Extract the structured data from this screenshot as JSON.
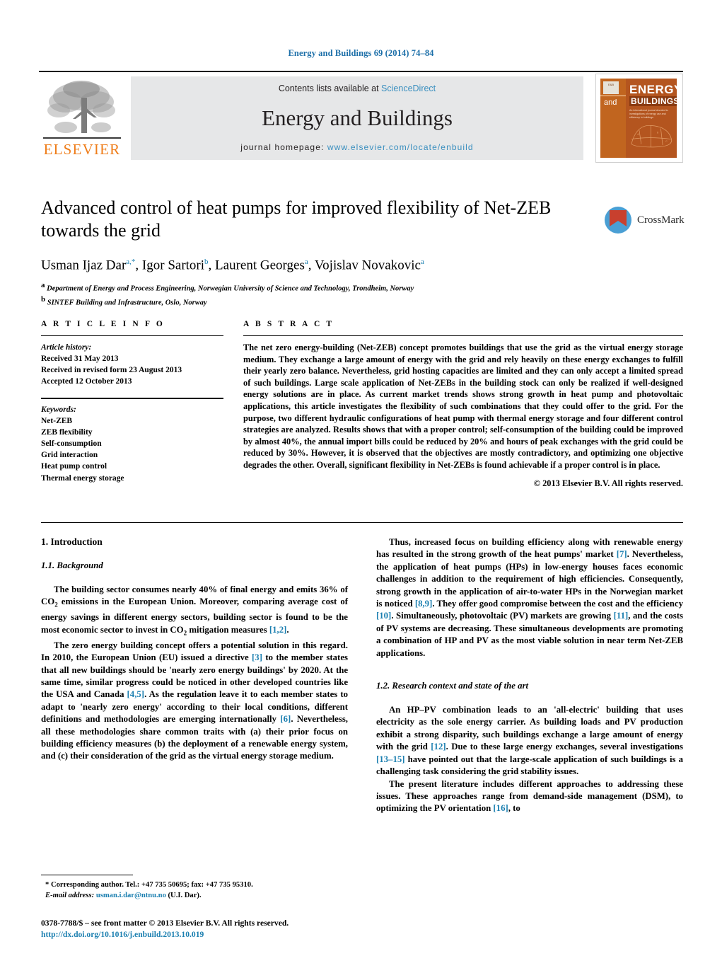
{
  "running_head": "Energy and Buildings 69 (2014) 74–84",
  "masthead": {
    "contents_prefix": "Contents lists available at ",
    "sciencedirect": "ScienceDirect",
    "journal_title": "Energy and Buildings",
    "homepage_prefix": "journal homepage:",
    "homepage_url": "www.elsevier.com/locate/enbuild",
    "publisher_logo_text": "ELSEVIER",
    "cover": {
      "badge": "ENERGY AND BUILDINGS",
      "and": "and",
      "energy": "ENERGY",
      "buildings": "BUILDINGS",
      "subtitle": "An international journal devoted to investigations of energy use and efficiency in buildings"
    }
  },
  "article": {
    "title": "Advanced control of heat pumps for improved flexibility of Net-ZEB towards the grid",
    "authors_html": "Usman Ijaz Dar<sup>a,*</sup>, Igor Sartori<sup>b</sup>, Laurent Georges<sup>a</sup>, Vojislav Novakovic<sup>a</sup>",
    "affiliations": [
      {
        "marker": "a",
        "text": "Department of Energy and Process Engineering, Norwegian University of Science and Technology, Trondheim, Norway"
      },
      {
        "marker": "b",
        "text": "SINTEF Building and Infrastructure, Oslo, Norway"
      }
    ],
    "crossmark_label": "CrossMark"
  },
  "article_info": {
    "heading": "A R T I C L E   I N F O",
    "history_label": "Article history:",
    "history": [
      "Received 31 May 2013",
      "Received in revised form 23 August 2013",
      "Accepted 12 October 2013"
    ],
    "keywords_label": "Keywords:",
    "keywords": [
      "Net-ZEB",
      "ZEB flexibility",
      "Self-consumption",
      "Grid interaction",
      "Heat pump control",
      "Thermal energy storage"
    ]
  },
  "abstract": {
    "heading": "A B S T R A C T",
    "text": "The net zero energy-building (Net-ZEB) concept promotes buildings that use the grid as the virtual energy storage medium. They exchange a large amount of energy with the grid and rely heavily on these energy exchanges to fulfill their yearly zero balance. Nevertheless, grid hosting capacities are limited and they can only accept a limited spread of such buildings. Large scale application of Net-ZEBs in the building stock can only be realized if well-designed energy solutions are in place. As current market trends shows strong growth in heat pump and photovoltaic applications, this article investigates the flexibility of such combinations that they could offer to the grid. For the purpose, two different hydraulic configurations of heat pump with thermal energy storage and four different control strategies are analyzed. Results shows that with a proper control; self-consumption of the building could be improved by almost 40%, the annual import bills could be reduced by 20% and hours of peak exchanges with the grid could be reduced by 30%. However, it is observed that the objectives are mostly contradictory, and optimizing one objective degrades the other. Overall, significant flexibility in Net-ZEBs is found achievable if a proper control is in place.",
    "copyright": "© 2013 Elsevier B.V. All rights reserved."
  },
  "body": {
    "section_heading": "1.  Introduction",
    "subsection_1": "1.1.  Background",
    "subsection_2": "1.2.  Research context and state of the art",
    "left_paragraphs": [
      "The building sector consumes nearly 40% of final energy and emits 36% of CO<sub>2</sub> emissions in the European Union. Moreover, comparing average cost of energy savings in different energy sectors, building sector is found to be the most economic sector to invest in CO<sub>2</sub> mitigation measures <span class=\"ref\">[1,2]</span>.",
      "The zero energy building concept offers a potential solution in this regard. In 2010, the European Union (EU) issued a directive <span class=\"ref\">[3]</span> to the member states that all new buildings should be 'nearly zero energy buildings' by 2020. At the same time, similar progress could be noticed in other developed countries like the USA and Canada <span class=\"ref\">[4,5]</span>. As the regulation leave it to each member states to adapt to 'nearly zero energy' according to their local conditions, different definitions and methodologies are emerging internationally <span class=\"ref\">[6]</span>. Nevertheless, all these methodologies share common traits with (a) their prior focus on building efficiency measures (b) the deployment of a renewable energy system, and (c) their consideration of the grid as the virtual energy storage medium."
    ],
    "right_paragraphs": [
      "Thus, increased focus on building efficiency along with renewable energy has resulted in the strong growth of the heat pumps' market <span class=\"ref\">[7]</span>. Nevertheless, the application of heat pumps (HPs) in low-energy houses faces economic challenges in addition to the requirement of high efficiencies. Consequently, strong growth in the application of air-to-water HPs in the Norwegian market is noticed <span class=\"ref\">[8,9]</span>. They offer good compromise between the cost and the efficiency <span class=\"ref\">[10]</span>. Simultaneously, photovoltaic (PV) markets are growing <span class=\"ref\">[11]</span>, and the costs of PV systems are decreasing. These simultaneous developments are promoting a combination of HP and PV as the most viable solution in near term Net-ZEB applications."
    ],
    "right_paragraphs_2": [
      "An HP–PV combination leads to an 'all-electric' building that uses electricity as the sole energy carrier. As building loads and PV production exhibit a strong disparity, such buildings exchange a large amount of energy with the grid <span class=\"ref\">[12]</span>. Due to these large energy exchanges, several investigations <span class=\"ref\">[13–15]</span> have pointed out that the large-scale application of such buildings is a challenging task considering the grid stability issues.",
      "The present literature includes different approaches to addressing these issues. These approaches range from demand-side management (DSM), to optimizing the PV orientation <span class=\"ref\">[16]</span>, to"
    ]
  },
  "footnote": {
    "corresponding": "*  Corresponding author. Tel.: +47 735 50695; fax: +47 735 95310.",
    "email_label": "E-mail address:",
    "email": "usman.i.dar@ntnu.no",
    "email_suffix": " (U.I. Dar)."
  },
  "footer": {
    "issn_line": "0378-7788/$ – see front matter © 2013 Elsevier B.V. All rights reserved.",
    "doi_line": "http://dx.doi.org/10.1016/j.enbuild.2013.10.019"
  },
  "colors": {
    "link_blue": "#1b7fb0",
    "running_head_blue": "#1b6ea8",
    "elsevier_orange": "#ef7d1a",
    "masthead_grey": "#e6e7e8",
    "cover_orange": "#b4551f",
    "crossmark_red": "#c8402e",
    "crossmark_blue": "#4a9fd4"
  }
}
